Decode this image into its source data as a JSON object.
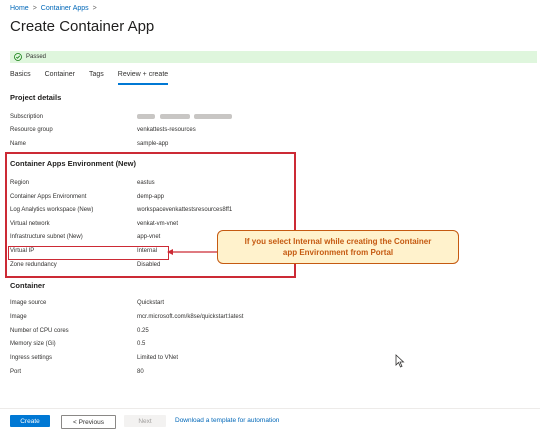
{
  "breadcrumb": {
    "home": "Home",
    "sep": ">",
    "container_apps": "Container Apps"
  },
  "page_title": "Create Container App",
  "more_label": "...",
  "validation": {
    "text": "Passed",
    "color": "#dff6dd"
  },
  "tabs": [
    {
      "label": "Basics",
      "active": false
    },
    {
      "label": "Container",
      "active": false
    },
    {
      "label": "Tags",
      "active": false
    },
    {
      "label": "Review + create",
      "active": true
    }
  ],
  "project_details": {
    "heading": "Project details",
    "subscription_label": "Subscription",
    "resource_group_label": "Resource group",
    "resource_group_value": "venkattests-resources",
    "name_label": "Name",
    "name_value": "sample-app"
  },
  "environment": {
    "heading": "Container Apps Environment (New)",
    "region_label": "Region",
    "region_value": "eastus",
    "env_label": "Container Apps Environment",
    "env_value": "demp-app",
    "law_label": "Log Analytics workspace (New)",
    "law_value": "workspacevenkattestsresources8ff1",
    "vnet_label": "Virtual network",
    "vnet_value": "venkat-vm-vnet",
    "subnet_label": "Infrastructure subnet (New)",
    "subnet_value": "app-vnet",
    "vip_label": "Virtual IP",
    "vip_value": "Internal",
    "zone_label": "Zone redundancy",
    "zone_value": "Disabled"
  },
  "container": {
    "heading": "Container",
    "image_source_label": "Image source",
    "image_source_value": "Quickstart",
    "image_label": "Image",
    "image_value": "mcr.microsoft.com/k8se/quickstart:latest",
    "cpu_label": "Number of CPU cores",
    "cpu_value": "0.25",
    "memory_label": "Memory size (Gi)",
    "memory_value": "0.5",
    "ingress_label": "Ingress settings",
    "ingress_value": "Limited to VNet",
    "port_label": "Port",
    "port_value": "80"
  },
  "callout": {
    "line1": "If you select Internal while creating the Container",
    "line2": "app Environment from Portal"
  },
  "footer": {
    "create": "Create",
    "previous": "< Previous",
    "next": "Next",
    "download": "Download a template for automation"
  },
  "colors": {
    "accent": "#0078d4",
    "annotation_red": "#cc2a35",
    "callout_orange": "#c55a11",
    "callout_fill": "#fff2cc"
  }
}
